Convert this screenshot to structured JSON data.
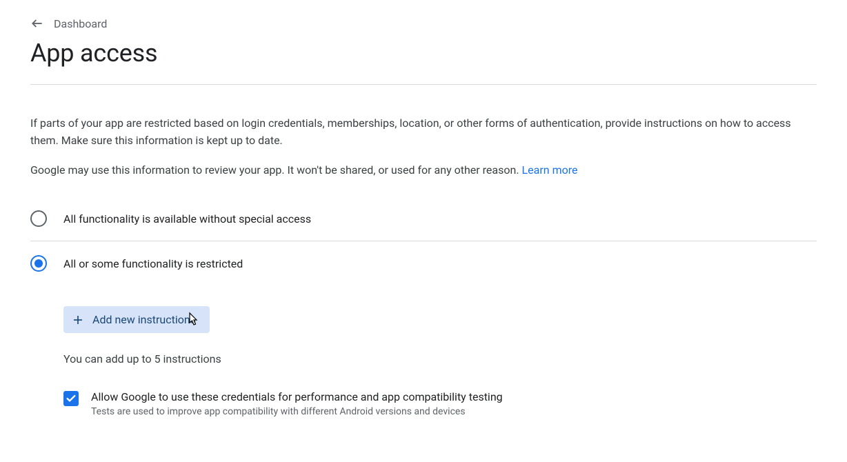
{
  "breadcrumb": {
    "label": "Dashboard"
  },
  "page": {
    "title": "App access"
  },
  "intro": {
    "paragraph1": "If parts of your app are restricted based on login credentials, memberships, location, or other forms of authentication, provide instructions on how to access them. Make sure this information is kept up to date.",
    "paragraph2_prefix": "Google may use this information to review your app. It won't be shared, or used for any other reason. ",
    "learn_more": "Learn more"
  },
  "options": {
    "unrestricted": "All functionality is available without special access",
    "restricted": "All or some functionality is restricted"
  },
  "add_button": {
    "label": "Add new instructions"
  },
  "hint": {
    "text": "You can add up to 5 instructions"
  },
  "checkbox": {
    "primary": "Allow Google to use these credentials for performance and app compatibility testing",
    "secondary": "Tests are used to improve app compatibility with different Android versions and devices"
  }
}
